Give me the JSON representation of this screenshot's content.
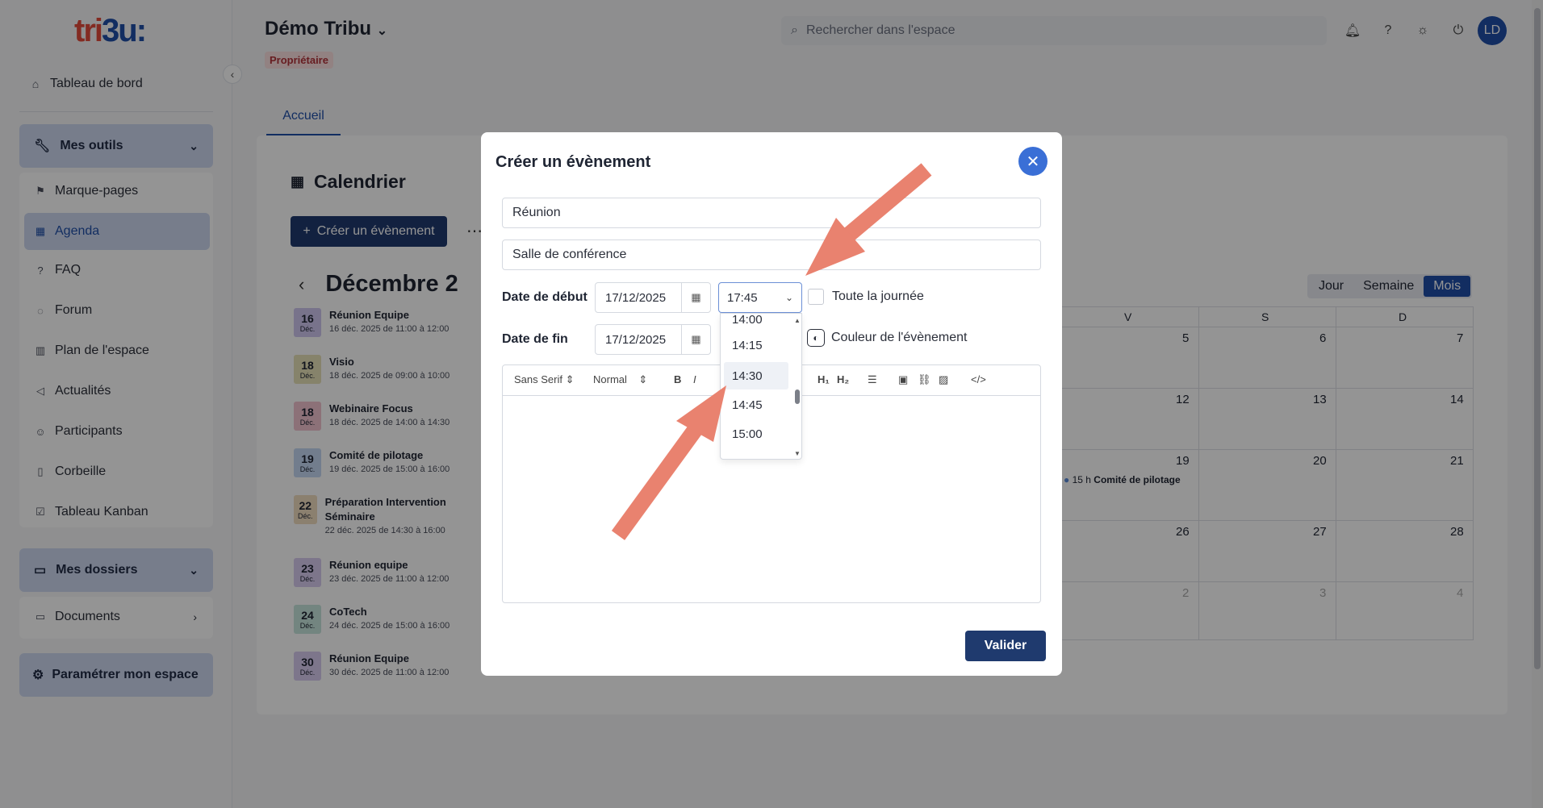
{
  "logo": {
    "text_a": "tri",
    "text_b": "3u",
    "text_c": ":"
  },
  "sidebar": {
    "dashboard": "Tableau de bord",
    "tools_group": "Mes outils",
    "tools": [
      {
        "label": "Marque-pages",
        "icon": "bookmark-icon"
      },
      {
        "label": "Agenda",
        "icon": "calendar-icon",
        "active": true
      },
      {
        "label": "FAQ",
        "icon": "help-icon"
      },
      {
        "label": "Forum",
        "icon": "chat-icon"
      },
      {
        "label": "Plan de l'espace",
        "icon": "map-icon"
      },
      {
        "label": "Actualités",
        "icon": "megaphone-icon"
      },
      {
        "label": "Participants",
        "icon": "people-icon"
      },
      {
        "label": "Corbeille",
        "icon": "trash-icon"
      },
      {
        "label": "Tableau Kanban",
        "icon": "kanban-icon"
      }
    ],
    "folders_group": "Mes dossiers",
    "documents": "Documents",
    "settings": "Paramétrer mon espace"
  },
  "header": {
    "space_title": "Démo Tribu",
    "role_badge": "Propriétaire",
    "search_placeholder": "Rechercher dans l'espace",
    "avatar_initials": "LD"
  },
  "main": {
    "tab": "Accueil",
    "calendar_title": "Calendrier",
    "create_button": "Créer un évènement",
    "month_label": "Décembre",
    "month_cut": "2",
    "views": [
      "Jour",
      "Semaine",
      "Mois"
    ],
    "active_view": "Mois",
    "events": [
      {
        "day": "16",
        "mon": "Déc.",
        "title": "Réunion Equipe",
        "time": "16 déc. 2025 de 11:00 à 12:00",
        "color": "#cfc6ef"
      },
      {
        "day": "18",
        "mon": "Déc.",
        "title": "Visio",
        "time": "18 déc. 2025 de 09:00 à 10:00",
        "color": "#e7e2b8"
      },
      {
        "day": "18",
        "mon": "Déc.",
        "title": "Webinaire Focus",
        "time": "18 déc. 2025 de 14:00 à 14:30",
        "color": "#f2c3cf"
      },
      {
        "day": "19",
        "mon": "Déc.",
        "title": "Comité de pilotage",
        "time": "19 déc. 2025 de 15:00 à 16:00",
        "color": "#c5d8f3"
      },
      {
        "day": "22",
        "mon": "Déc.",
        "title": "Préparation Intervention Séminaire",
        "time": "22 déc. 2025 de 14:30 à 16:00",
        "color": "#f0dcc0"
      },
      {
        "day": "23",
        "mon": "Déc.",
        "title": "Réunion equipe",
        "time": "23 déc. 2025 de 11:00 à 12:00",
        "color": "#d8cbef"
      },
      {
        "day": "24",
        "mon": "Déc.",
        "title": "CoTech",
        "time": "24 déc. 2025 de 15:00 à 16:00",
        "color": "#c6e6dc"
      },
      {
        "day": "30",
        "mon": "Déc.",
        "title": "Réunion Equipe",
        "time": "30 déc. 2025 de 11:00 à 12:00",
        "color": "#d8cbef"
      }
    ],
    "grid_headers": [
      "V",
      "S",
      "D"
    ],
    "grid_rows": [
      [
        "5",
        "6",
        "7"
      ],
      [
        "12",
        "13",
        "14"
      ],
      [
        "19",
        "20",
        "21"
      ],
      [
        "26",
        "27",
        "28"
      ],
      [
        "2",
        "3",
        "4"
      ]
    ],
    "grid_event_time": "15 h",
    "grid_event_title": "Comité de pilotage"
  },
  "modal": {
    "title": "Créer un évènement",
    "name_value": "Réunion",
    "location_value": "Salle de conférence",
    "start_label": "Date de début",
    "start_date": "17/12/2025",
    "start_time": "17:45",
    "all_day_label": "Toute la journée",
    "end_label": "Date de fin",
    "end_date": "17/12/2025",
    "color_label": "Couleur de l'évènement",
    "time_options": [
      "14:00",
      "14:15",
      "14:30",
      "14:45",
      "15:00"
    ],
    "highlighted_option": "14:30",
    "editor": {
      "font": "Sans Serif",
      "size": "Normal",
      "bold": "B",
      "italic": "I",
      "h1": "H₁",
      "h2": "H₂"
    },
    "validate": "Valider"
  },
  "colors": {
    "accent": "#1f4fa8",
    "primary_button": "#1f3a6e",
    "annotation_arrow": "#e9826f"
  }
}
